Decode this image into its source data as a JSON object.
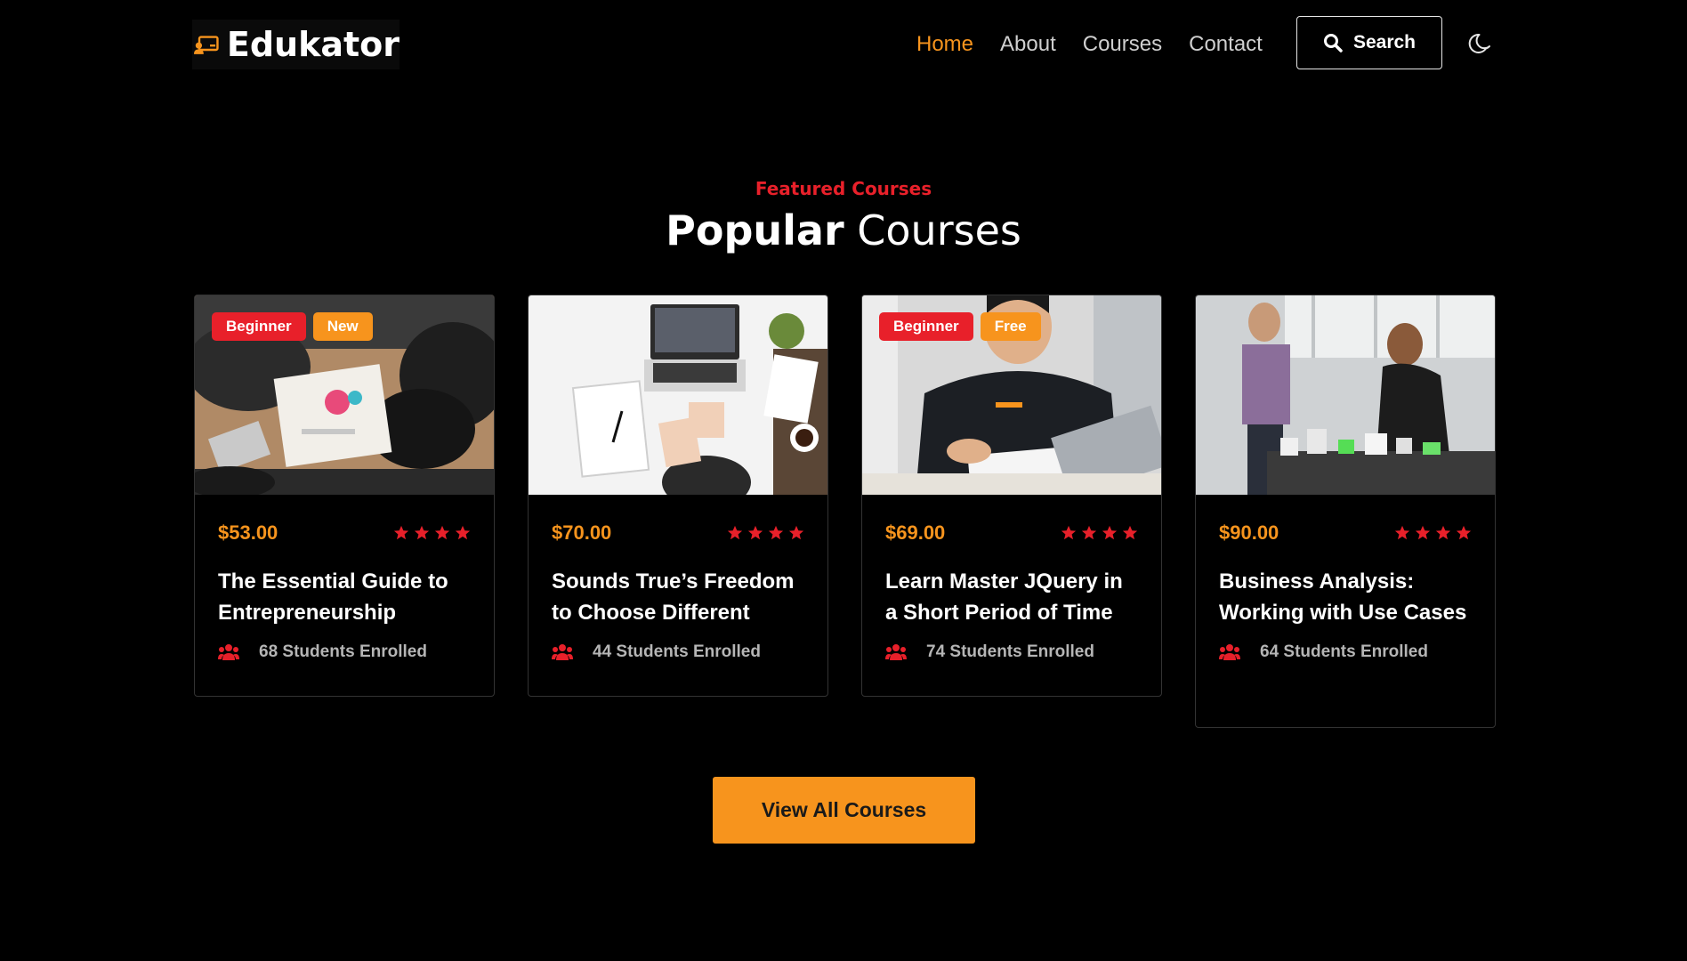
{
  "brand": {
    "name": "Edukator",
    "accent": "#f7941d",
    "secondary": "#e8202a"
  },
  "nav": {
    "items": [
      {
        "label": "Home",
        "active": true
      },
      {
        "label": "About",
        "active": false
      },
      {
        "label": "Courses",
        "active": false
      },
      {
        "label": "Contact",
        "active": false
      }
    ],
    "search_label": "Search",
    "search_icon": "search-icon",
    "theme_icon": "moon-icon"
  },
  "section": {
    "eyebrow": "Featured Courses",
    "title_bold": "Popular",
    "title_light": "Courses"
  },
  "courses": [
    {
      "badges": [
        {
          "label": "Beginner",
          "color": "red"
        },
        {
          "label": "New",
          "color": "orange"
        }
      ],
      "price": "$53.00",
      "rating": 4,
      "title": "The Essential Guide to Entrepreneurship",
      "enrolled": "68 Students Enrolled",
      "image": "team-workshop-photo"
    },
    {
      "badges": [],
      "price": "$70.00",
      "rating": 4,
      "title": "Sounds True’s Freedom to Choose Different",
      "enrolled": "44 Students Enrolled",
      "image": "laptop-desk-photo"
    },
    {
      "badges": [
        {
          "label": "Beginner",
          "color": "red"
        },
        {
          "label": "Free",
          "color": "orange"
        }
      ],
      "price": "$69.00",
      "rating": 4,
      "title": "Learn Master JQuery in a Short Period of Time",
      "enrolled": "74 Students Enrolled",
      "image": "student-writing-photo"
    },
    {
      "badges": [],
      "price": "$90.00",
      "rating": 4,
      "title": "Business Analysis: Working with Use Cases",
      "enrolled": "64 Students Enrolled",
      "image": "architecture-model-photo"
    }
  ],
  "cta": {
    "label": "View All Courses"
  }
}
